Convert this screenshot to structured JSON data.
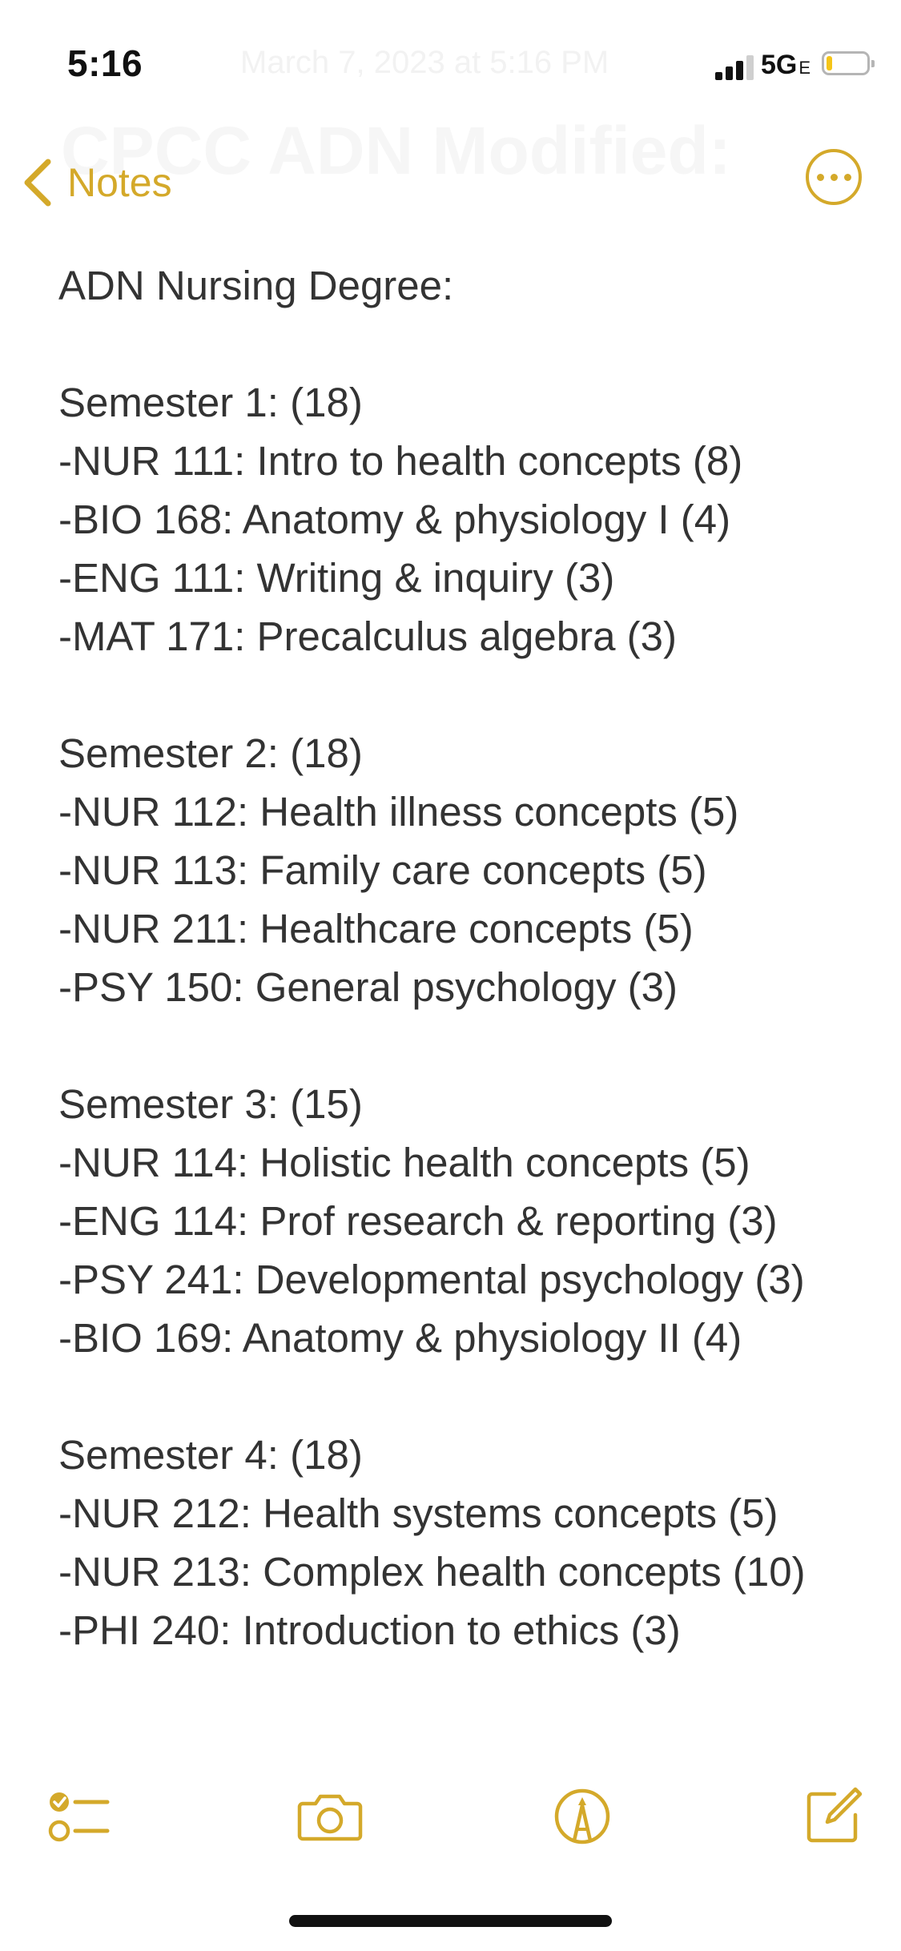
{
  "status_bar": {
    "time": "5:16",
    "network": "5G",
    "network_suffix": "E",
    "battery_level": 0.15
  },
  "header_ghost": {
    "date": "March 7, 2023 at 5:16 PM",
    "title": "CPCC ADN Modified:"
  },
  "nav": {
    "back_label": "Notes",
    "more_icon": "ellipsis-circle-icon"
  },
  "note": {
    "heading": "ADN Nursing Degree:",
    "semester1": {
      "title": "Semester 1: (18)",
      "items": [
        "-NUR 111: Intro to health concepts (8)",
        "-BIO 168: Anatomy & physiology I (4)",
        "-ENG 111: Writing & inquiry (3)",
        "-MAT 171: Precalculus algebra (3)"
      ]
    },
    "semester2": {
      "title": "Semester 2: (18)",
      "items": [
        "-NUR 112: Health illness concepts (5)",
        "-NUR 113: Family care concepts (5)",
        "-NUR 211: Healthcare concepts (5)",
        "-PSY 150: General psychology (3)"
      ]
    },
    "semester3": {
      "title": "Semester 3: (15)",
      "items": [
        "-NUR 114: Holistic health concepts (5)",
        "-ENG 114: Prof research & reporting (3)",
        "-PSY 241: Developmental psychology (3)",
        "-BIO 169: Anatomy & physiology II (4)"
      ]
    },
    "semester4": {
      "title": "Semester 4: (18)",
      "items": [
        "-NUR 212: Health systems concepts (5)",
        "-NUR 213: Complex health concepts (10)",
        "-PHI 240: Introduction to ethics (3)"
      ]
    }
  },
  "toolbar": {
    "icons": [
      "checklist-icon",
      "camera-icon",
      "markup-pen-icon",
      "compose-icon"
    ]
  },
  "colors": {
    "accent": "#d4a92a",
    "text": "#333333",
    "background": "#ffffff"
  }
}
